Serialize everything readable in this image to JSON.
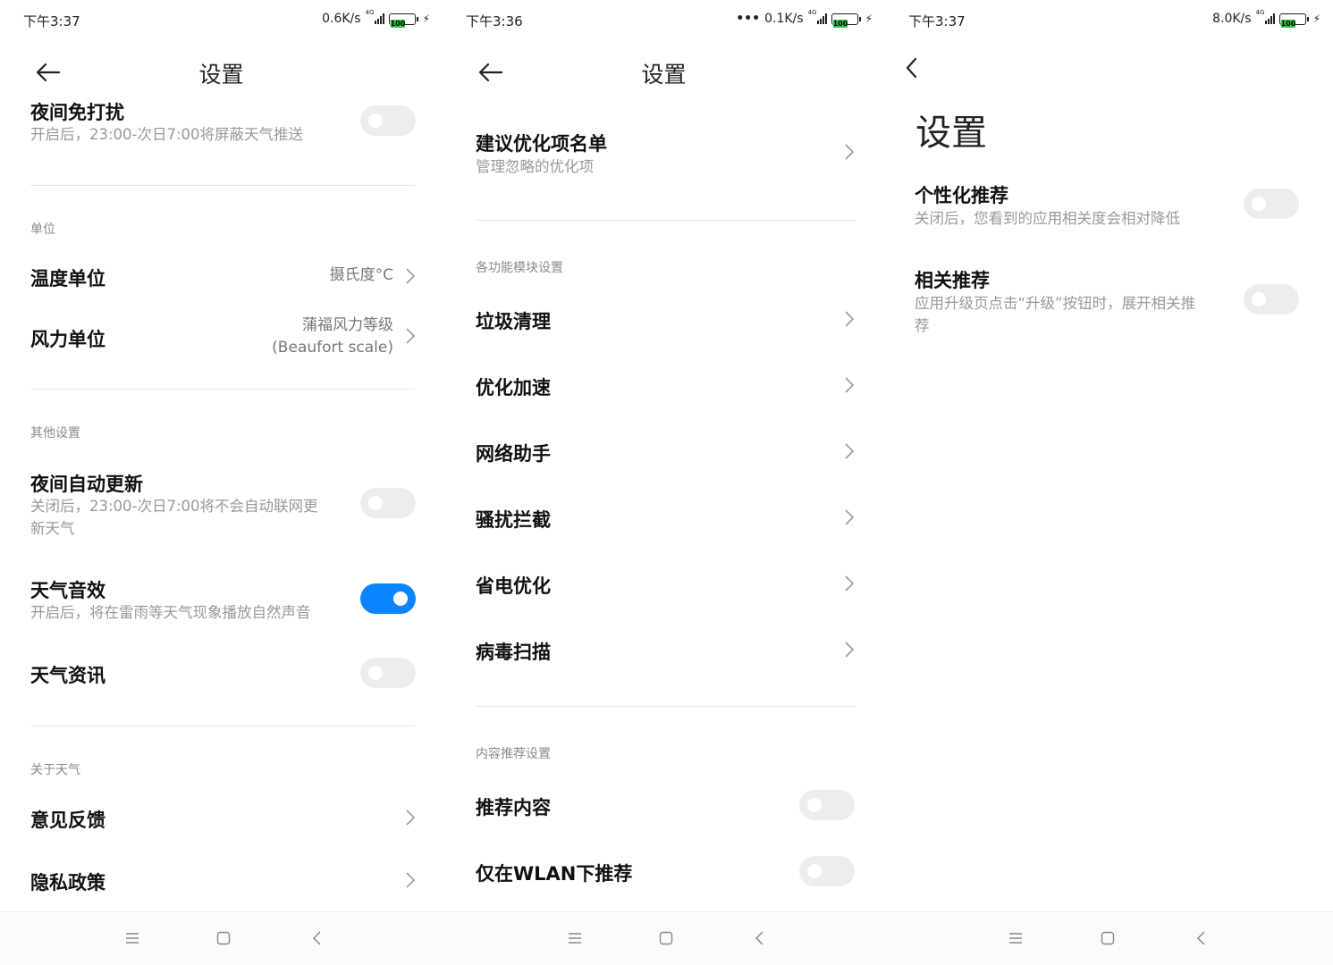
{
  "screens": [
    {
      "status": {
        "time": "下午3:37",
        "speed": "0.6K/s",
        "network": "4G",
        "battery": "100"
      },
      "header": {
        "title": "设置"
      },
      "rows": {
        "night_dnd": {
          "title": "夜间免打扰",
          "subtitle": "开启后，23:00-次日7:00将屏蔽天气推送",
          "enabled": false
        },
        "section_units": "单位",
        "temp_unit": {
          "title": "温度单位",
          "value": "摄氏度°C"
        },
        "wind_unit": {
          "title": "风力单位",
          "value_line1": "蒲福风力等级",
          "value_line2": "(Beaufort scale)"
        },
        "section_other": "其他设置",
        "night_update": {
          "title": "夜间自动更新",
          "subtitle_line1": "关闭后，23:00-次日7:00将不会自动联网更",
          "subtitle_line2": "新天气",
          "enabled": false
        },
        "weather_sound": {
          "title": "天气音效",
          "subtitle": "开启后，将在雷雨等天气现象播放自然声音",
          "enabled": true
        },
        "weather_news": {
          "title": "天气资讯",
          "enabled": false
        },
        "section_about": "关于天气",
        "feedback": {
          "title": "意见反馈"
        },
        "privacy": {
          "title": "隐私政策"
        }
      }
    },
    {
      "status": {
        "time": "下午3:36",
        "speed": "0.1K/s",
        "network": "4G",
        "battery": "100"
      },
      "header": {
        "title": "设置"
      },
      "rows": {
        "suggest_list": {
          "title": "建议优化项名单",
          "subtitle": "管理忽略的优化项"
        },
        "section_modules": "各功能模块设置",
        "junk_clean": {
          "title": "垃圾清理"
        },
        "speed_up": {
          "title": "优化加速"
        },
        "net_assist": {
          "title": "网络助手"
        },
        "harass_block": {
          "title": "骚扰拦截"
        },
        "power_save": {
          "title": "省电优化"
        },
        "virus_scan": {
          "title": "病毒扫描"
        },
        "section_recommend": "内容推荐设置",
        "recommend_content": {
          "title": "推荐内容",
          "enabled": false
        },
        "wlan_only": {
          "title": "仅在WLAN下推荐",
          "enabled": false
        }
      }
    },
    {
      "status": {
        "time": "下午3:37",
        "speed": "8.0K/s",
        "network": "4G",
        "battery": "100"
      },
      "header": {
        "title": "设置"
      },
      "rows": {
        "personalized": {
          "title": "个性化推荐",
          "subtitle": "关闭后，您看到的应用相关度会相对降低",
          "enabled": false
        },
        "related": {
          "title": "相关推荐",
          "subtitle_line1": "应用升级页点击“升级”按钮时，展开相关推",
          "subtitle_line2": "荐",
          "enabled": false
        }
      }
    }
  ],
  "icons": {
    "back": "arrow-left-icon",
    "back_chevron": "chevron-left-icon",
    "chevron": "chevron-right-icon",
    "nav_menu": "menu-icon",
    "nav_home": "home-icon",
    "nav_back": "back-icon"
  },
  "colors": {
    "accent": "#0d84ff",
    "toggle_off": "#ededed",
    "subtext": "#999999",
    "battery": "#2ec447"
  }
}
